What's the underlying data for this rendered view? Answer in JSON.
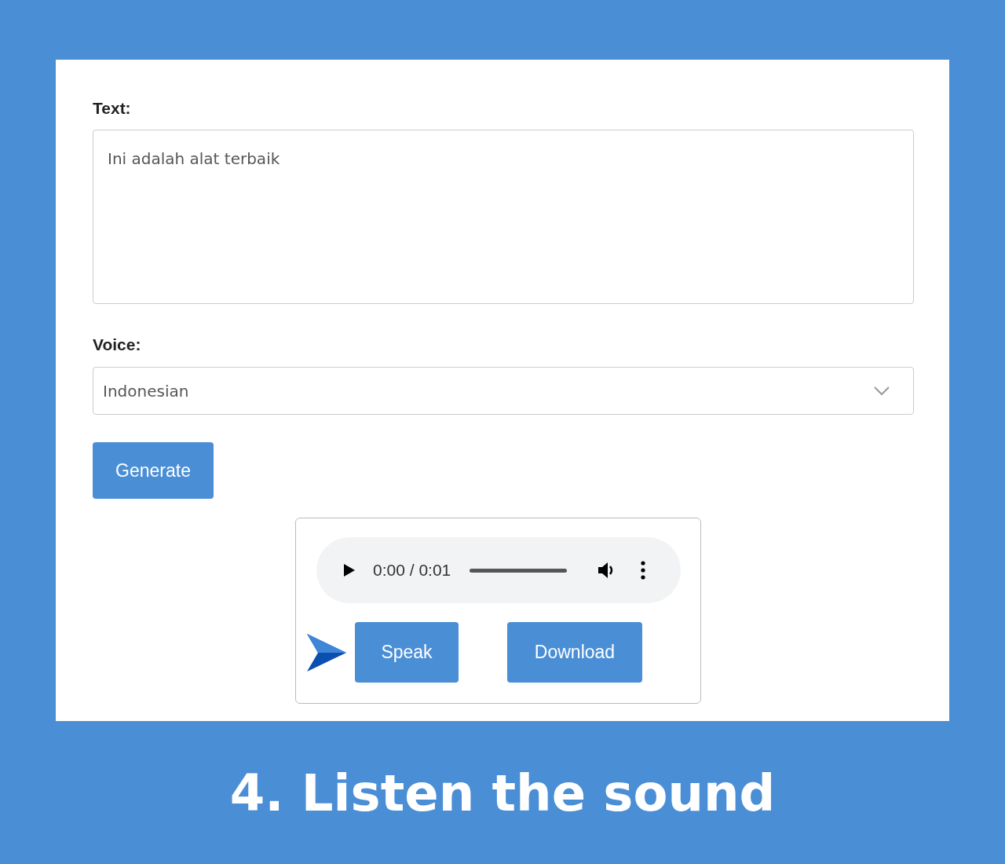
{
  "form": {
    "text_label": "Text:",
    "text_value": "Ini adalah alat terbaik",
    "voice_label": "Voice:",
    "voice_value": "Indonesian",
    "generate_button": "Generate"
  },
  "player": {
    "time": "0:00 / 0:01",
    "buttons": [
      "Speak",
      "Download"
    ]
  },
  "caption": "4. Listen the sound"
}
